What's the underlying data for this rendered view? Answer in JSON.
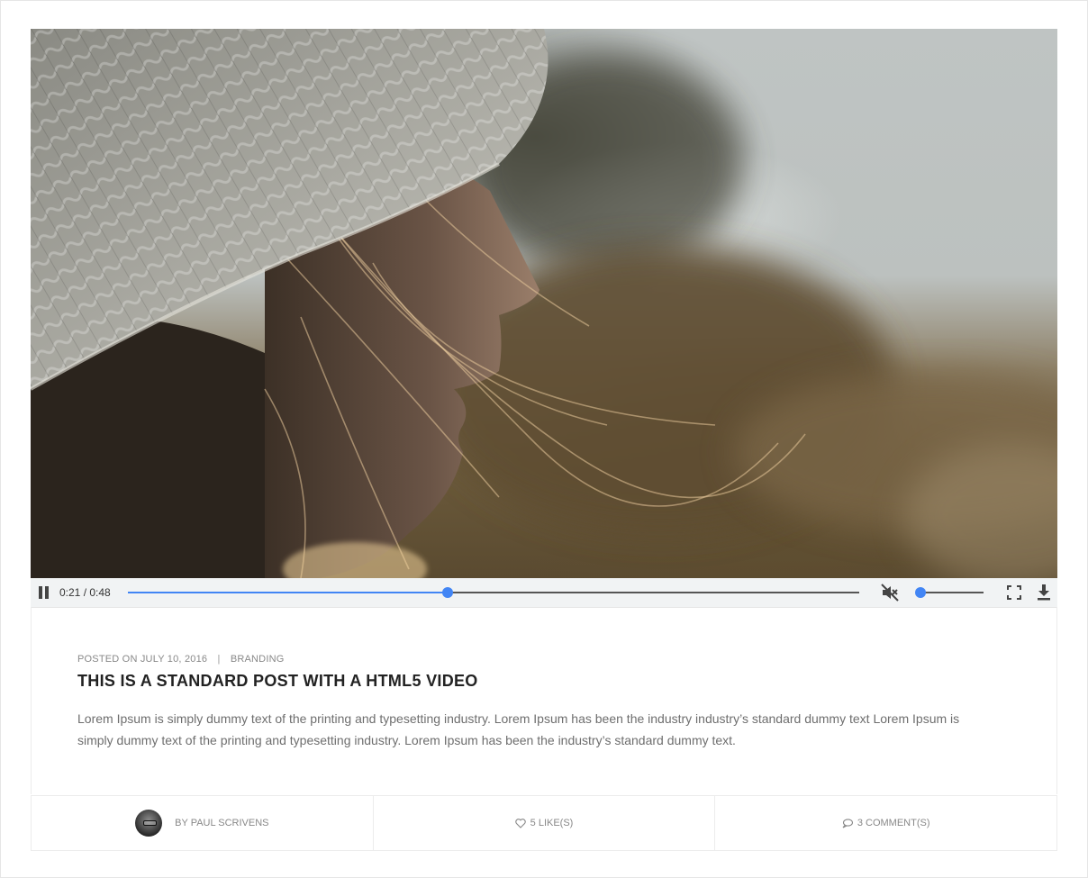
{
  "video": {
    "time_display": "0:21 / 0:48",
    "progress_fraction": 0.4375,
    "volume_fraction": 0.0,
    "muted": true,
    "accent_color": "#4285f4"
  },
  "post": {
    "meta_prefix": "POSTED ON",
    "date": "JULY 10, 2016",
    "separator": "|",
    "category": "BRANDING",
    "title": "THIS IS A STANDARD POST WITH A HTML5 VIDEO",
    "excerpt": "Lorem Ipsum is simply dummy text of the printing and typesetting industry. Lorem Ipsum has been the industry industry’s standard dummy text Lorem Ipsum is simply dummy text of the printing and typesetting industry. Lorem Ipsum has been the industry’s standard dummy text."
  },
  "footer": {
    "author": "BY PAUL SCRIVENS",
    "likes": "5 LIKE(S)",
    "comments": "3 COMMENT(S)",
    "icons": [
      "avatar",
      "heart-icon",
      "comment-icon"
    ]
  }
}
